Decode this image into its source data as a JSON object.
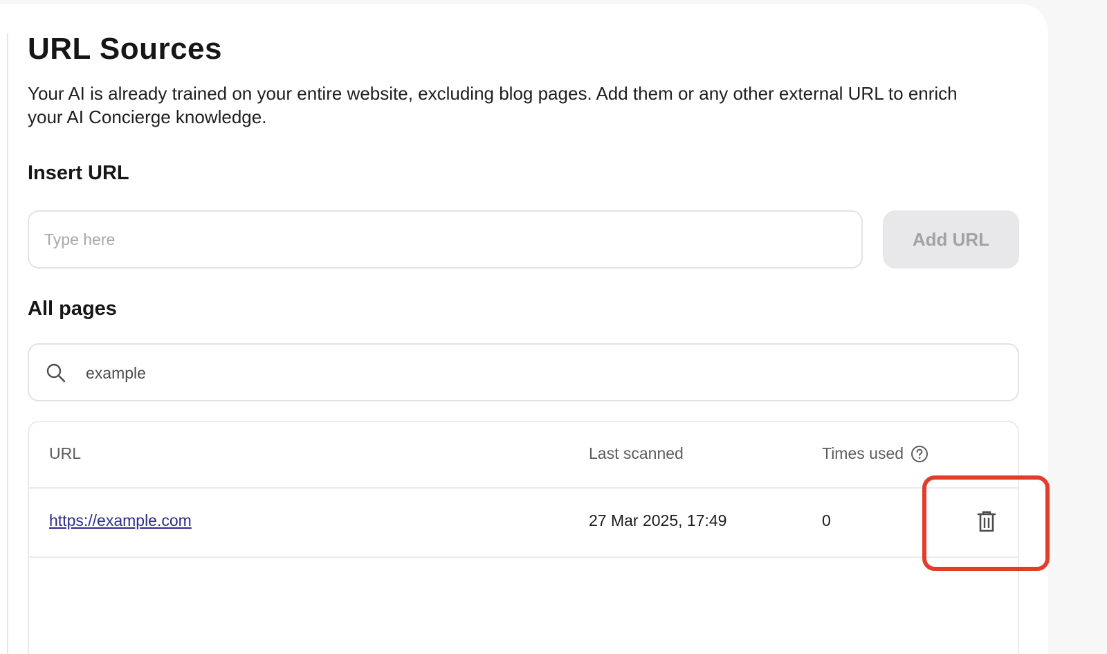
{
  "header": {
    "title": "URL Sources",
    "description": "Your AI is already trained on your entire website, excluding blog pages. Add them or any other external URL to enrich your AI Concierge knowledge."
  },
  "insert": {
    "title": "Insert URL",
    "placeholder": "Type here",
    "value": "",
    "add_label": "Add URL"
  },
  "pages": {
    "title": "All pages",
    "search_value": "example",
    "search_icon": "search-icon",
    "columns": {
      "url": "URL",
      "last_scanned": "Last scanned",
      "times_used": "Times used"
    },
    "help_icon": "question-circle-icon",
    "rows": [
      {
        "url": "https://example.com",
        "last_scanned": "27 Mar 2025, 17:49",
        "times_used": "0",
        "action_icon": "trash-icon"
      }
    ]
  },
  "annotation": {
    "color": "#e23c2a",
    "target": "delete-button"
  }
}
